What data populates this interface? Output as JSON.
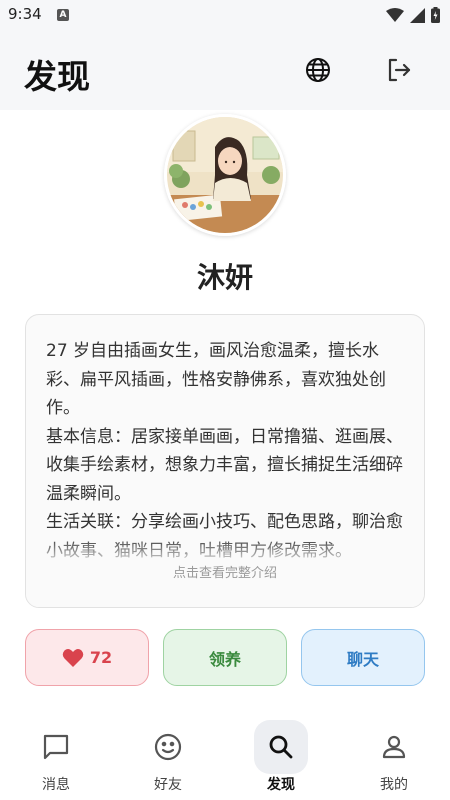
{
  "status_bar": {
    "time": "9:34",
    "notification_icon": "A"
  },
  "header": {
    "title": "发现",
    "globe_icon": "globe-icon",
    "logout_icon": "logout-icon"
  },
  "profile": {
    "name": "沐妍",
    "bio": [
      "27 岁自由插画女生，画风治愈温柔，擅长水彩、扁平风插画，性格安静佛系，喜欢独处创作。",
      "基本信息：居家接单画画，日常撸猫、逛画展、收集手绘素材，想象力丰富，擅长捕捉生活细碎温柔瞬间。",
      "生活关联：分享绘画小技巧、配色思路，聊治愈小故事、猫咪日常，吐槽甲方修改需求。"
    ],
    "more_label": "点击查看完整介绍"
  },
  "actions": {
    "like_count": "72",
    "adopt_label": "领养",
    "chat_label": "聊天"
  },
  "bottom_nav": [
    {
      "label": "消息",
      "icon": "message-icon"
    },
    {
      "label": "好友",
      "icon": "smile-icon"
    },
    {
      "label": "发现",
      "icon": "search-icon",
      "active": true
    },
    {
      "label": "我的",
      "icon": "person-icon"
    }
  ],
  "colors": {
    "like": "#d9434d",
    "adopt": "#3a8a3e",
    "chat": "#2f7cc4",
    "header_bg": "#f6f7f9"
  }
}
